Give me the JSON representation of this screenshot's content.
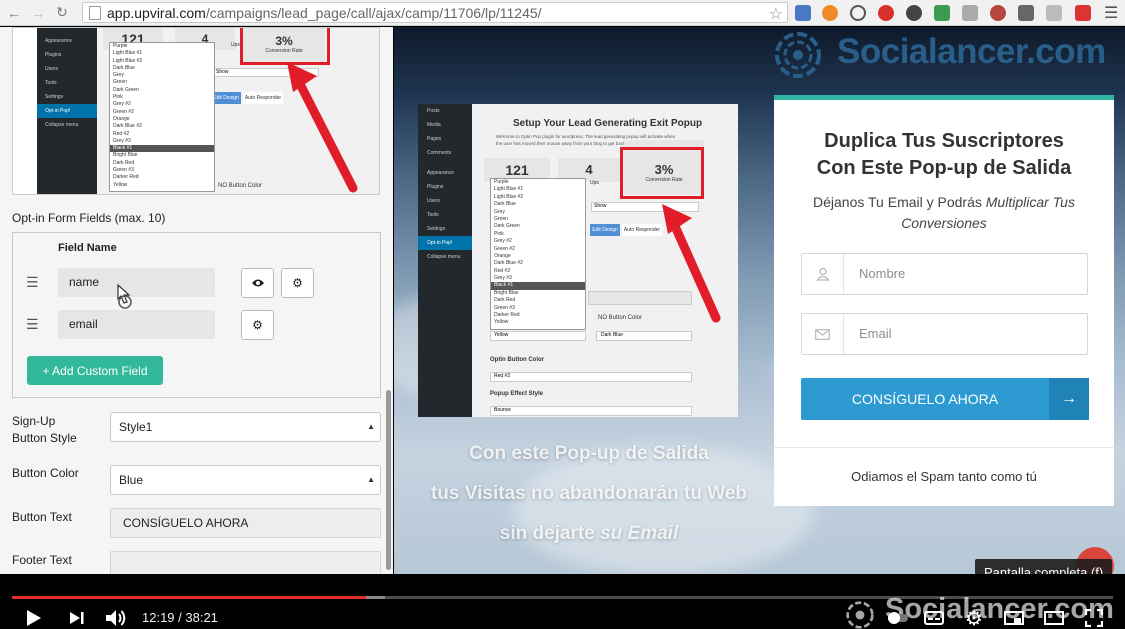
{
  "browser": {
    "url_host": "app.upviral.com",
    "url_path": "/campaigns/lead_page/call/ajax/camp/11706/lp/11245/"
  },
  "builder": {
    "mini_preview": {
      "stat_1": "121",
      "stat_2": "4",
      "stat_3": "3%",
      "stat_3_label": "Conversion Rate",
      "tab_1": "Edit Design",
      "tab_2": "Auto Responder",
      "field_show": "Show",
      "no_button_color": "NO Button Color",
      "stat_2_label": "Ups",
      "colors": [
        "Purple",
        "Light Blue #1",
        "Light Blue #2",
        "Dark Blue",
        "Grey",
        "Green",
        "Dark Green",
        "Pink",
        "Grey #2",
        "Green #2",
        "Orange",
        "Dark Blue #2",
        "Red #2",
        "Grey #3",
        "Black #1",
        "Bright Blue",
        "Dark Red",
        "Green #3",
        "Darker Red",
        "Yellow"
      ],
      "menu": [
        "Appearance",
        "Plugins",
        "Users",
        "Tools",
        "Settings",
        "Opt-in Pop!",
        "Collapse menu"
      ]
    },
    "fields_title": "Opt-in Form Fields (max. 10)",
    "field_name_header": "Field Name",
    "fields": [
      {
        "value": "name"
      },
      {
        "value": "email"
      }
    ],
    "add_custom_field": "+ Add Custom Field",
    "sign_up_label_1": "Sign-Up",
    "sign_up_label_2": "Button Style",
    "sign_up_value": "Style1",
    "button_color_label": "Button Color",
    "button_color_value": "Blue",
    "button_text_label": "Button Text",
    "button_text_value": "CONSÍGUELO AHORA",
    "footer_text_label": "Footer Text"
  },
  "preview": {
    "logo": "Socialancer.com",
    "inner": {
      "title": "Setup Your Lead Generating Exit Popup",
      "intro_1": "Welcome to Optin Pop plugin for wordpress. The lead generating popup will activate when",
      "intro_2": "the user has moved their mouse away from your blog to get back to the...",
      "stat_1": "121",
      "stat_2": "4",
      "stat_2_label": "Ups",
      "stat_3": "3%",
      "stat_3_label": "Conversion Rate",
      "field_show": "Show",
      "tab_1": "Edit Design",
      "tab_2": "Auto Responder",
      "no_button_color": "NO Button Color",
      "no_button_value": "Dark Blue",
      "optin_button_color": "Optin Button Color",
      "optin_button_value": "Red #2",
      "popup_effect": "Popup Effect Style",
      "popup_effect_value": "Bounce",
      "dropdown_last": "Yellow",
      "menu": [
        "Posts",
        "Media",
        "Pages",
        "Comments",
        "Appearance",
        "Plugins",
        "Users",
        "Tools",
        "Settings",
        "Opt-in Pop!",
        "Collapse menu"
      ],
      "colors": [
        "Purple",
        "Light Blue #1",
        "Light Blue #2",
        "Dark Blue",
        "Grey",
        "Green",
        "Dark Green",
        "Pink",
        "Grey #2",
        "Green #2",
        "Orange",
        "Dark Blue #2",
        "Red #2",
        "Grey #3",
        "Black #1",
        "Bright Blue",
        "Dark Red",
        "Green #3",
        "Darker Red",
        "Yellow"
      ]
    },
    "headline_1": "Con este Pop-up de Salida",
    "headline_2": "tus Visitas no abandonarán tu Web",
    "headline_3a": "sin dejarte ",
    "headline_3b": "su Email",
    "card": {
      "title_1": "Duplica Tus Suscriptores",
      "title_2": "Con Este Pop-up de Salida",
      "sub_1": "Déjanos Tu Email y Podrás ",
      "sub_1_em": "Multiplicar Tus",
      "sub_2_em": "Conversiones",
      "name_placeholder": "Nombre",
      "email_placeholder": "Email",
      "cta": "CONSÍGUELO AHORA",
      "footer": "Odiamos el Spam tanto como tú"
    }
  },
  "player": {
    "time": "12:19 / 38:21",
    "tooltip": "Pantalla completa (f)",
    "watermark": "Socialancer.com",
    "progress_fraction": 0.3212,
    "buffer_fraction": 0.3388
  },
  "colors": {
    "accent_teal": "#32b89b",
    "cta_blue": "#2d9bd2",
    "progress_red": "#e32e26",
    "logo_blue": "#2a5e8a",
    "annotation_red": "#e11d2a"
  }
}
